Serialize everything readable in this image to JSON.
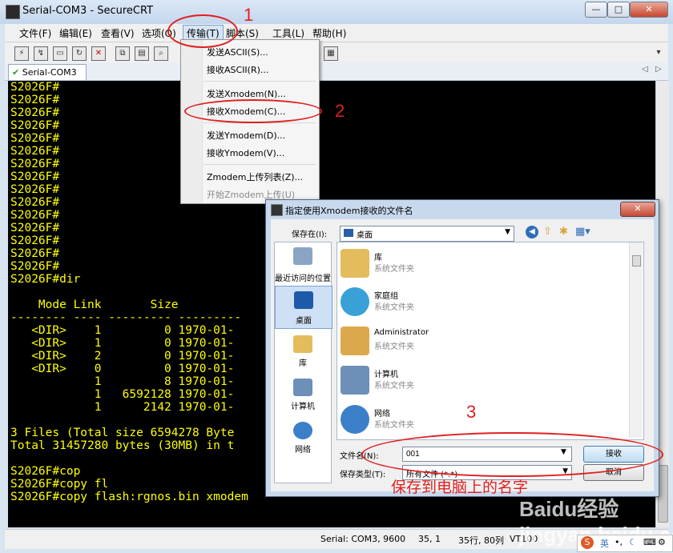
{
  "window": {
    "title": "Serial-COM3 - SecureCRT",
    "minimize": "—",
    "maximize": "□",
    "close": "✕"
  },
  "menubar": [
    "文件(F)",
    "编辑(E)",
    "查看(V)",
    "选项(O)",
    "传输(T)",
    "脚本(S)",
    "工具(L)",
    "帮助(H)"
  ],
  "tab": {
    "label": "Serial-COM3"
  },
  "terminal_lines": [
    "S2026F#",
    "S2026F#",
    "S2026F#",
    "S2026F#",
    "S2026F#",
    "S2026F#",
    "S2026F#",
    "S2026F#",
    "S2026F#",
    "S2026F#",
    "S2026F#",
    "S2026F#",
    "S2026F#",
    "S2026F#",
    "S2026F#",
    "S2026F#dir",
    "",
    "    Mode Link       Size",
    "-------- ---- --------- ---------",
    "   <DIR>    1         0 1970-01-",
    "   <DIR>    1         0 1970-01-",
    "   <DIR>    2         0 1970-01-",
    "   <DIR>    0         0 1970-01-",
    "            1         8 1970-01-",
    "            1   6592128 1970-01-",
    "            1      2142 1970-01-",
    "",
    "3 Files (Total size 6594278 Byte",
    "Total 31457280 bytes (30MB) in t",
    "",
    "S2026F#cop",
    "S2026F#copy fl",
    "S2026F#copy flash:rgnos.bin xmodem"
  ],
  "transfer_menu": {
    "send_ascii": "发送ASCII(S)...",
    "recv_ascii": "接收ASCII(R)...",
    "send_xmodem": "发送Xmodem(N)...",
    "recv_xmodem": "接收Xmodem(C)...",
    "send_ymodem": "发送Ymodem(D)...",
    "recv_ymodem": "接收Ymodem(V)...",
    "zmodem_list": "Zmodem上传列表(Z)...",
    "zmodem_start": "开始Zmodem上传(U)"
  },
  "dialog": {
    "title": "指定使用Xmodem接收的文件名",
    "save_in_label": "保存在(I):",
    "save_in_value": "桌面",
    "places": [
      "最近访问的位置",
      "桌面",
      "库",
      "计算机",
      "网络"
    ],
    "files": [
      {
        "name": "库",
        "type": "系统文件夹"
      },
      {
        "name": "家庭组",
        "type": "系统文件夹"
      },
      {
        "name": "Administrator",
        "type": "系统文件夹"
      },
      {
        "name": "计算机",
        "type": "系统文件夹"
      },
      {
        "name": "网络",
        "type": "系统文件夹"
      }
    ],
    "filename_label": "文件名(N):",
    "filename_value": "001",
    "filetype_label": "保存类型(T):",
    "filetype_value": "所有文件 (*.*)",
    "receive_button": "接收",
    "cancel_button": "取消"
  },
  "statusbar": {
    "connection": "Serial: COM3, 9600",
    "pos": "35,  1",
    "size": "35行, 80列",
    "term": "VT100"
  },
  "annotations": {
    "n1": "1",
    "n2": "2",
    "n3": "3",
    "note": "保存到电脑上的名字"
  },
  "watermark": "Baidu经验 jingyan.baidu.com",
  "colors": {
    "terminal_bg": "#000000",
    "terminal_fg": "#ffff00",
    "annotation": "#e02020"
  }
}
